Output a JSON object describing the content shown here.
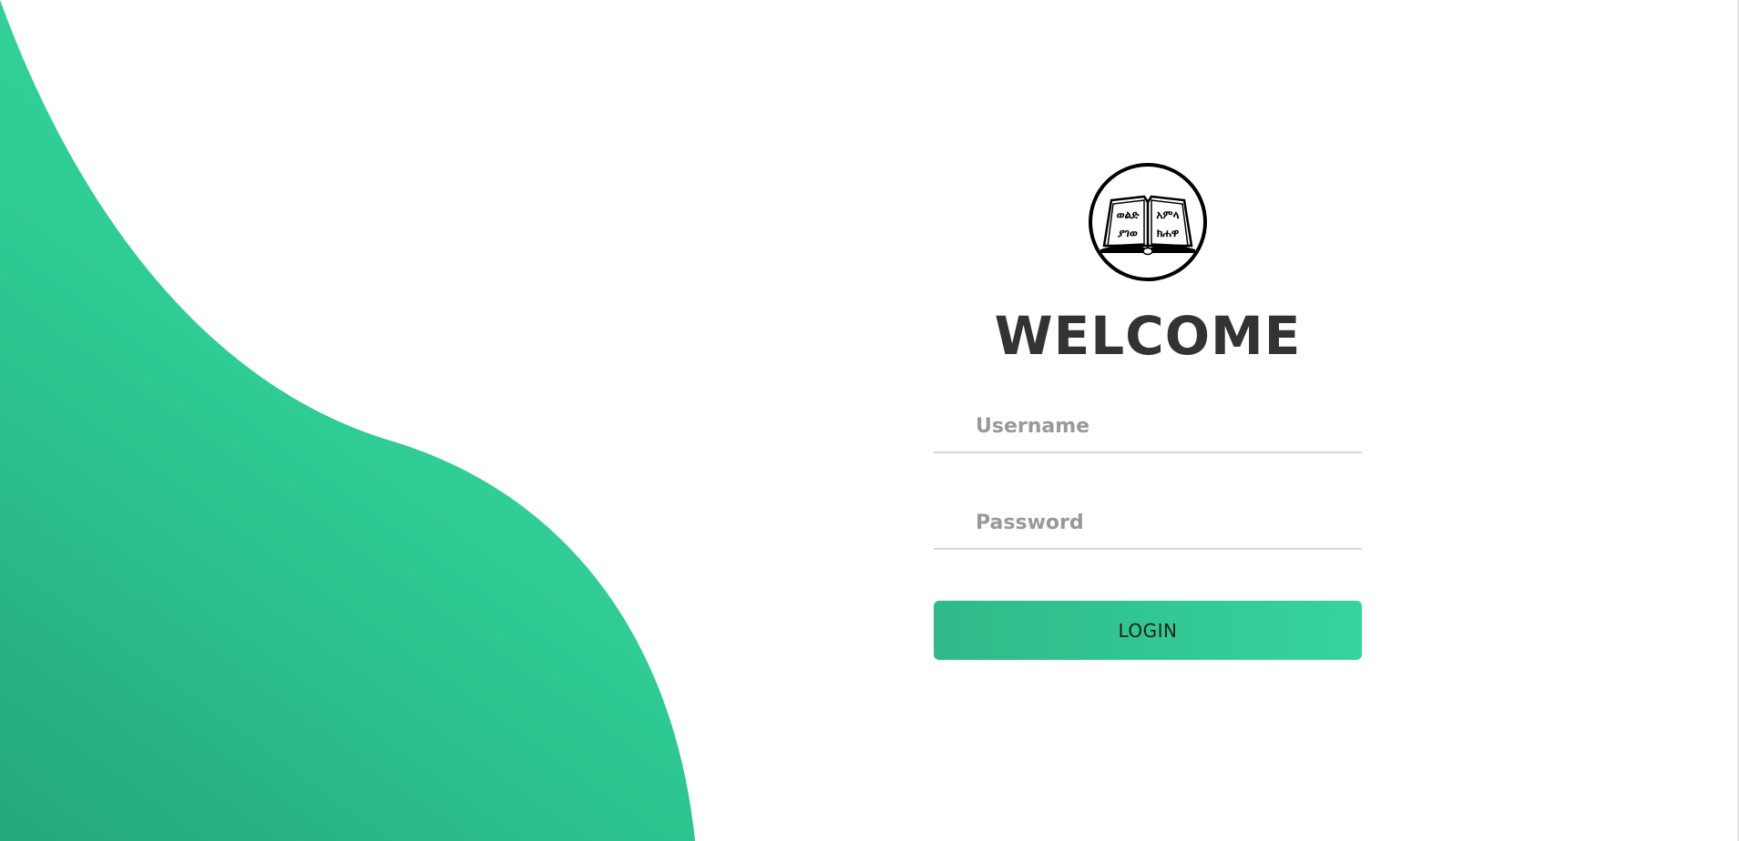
{
  "login": {
    "title": "WELCOME",
    "username": {
      "value": "",
      "placeholder": "Username"
    },
    "password": {
      "value": "",
      "placeholder": "Password"
    },
    "submit_label": "LOGIN"
  },
  "logo": {
    "icon": "open-book-emblem-icon",
    "glyphs_left": "ወልድ ያገወ",
    "glyphs_right": "አምላ ክሐዋ"
  },
  "colors": {
    "accent": "#2fd197",
    "accent_dark": "#24a77b",
    "title": "#333333",
    "placeholder": "#999999",
    "underline": "#d9d9d9"
  }
}
